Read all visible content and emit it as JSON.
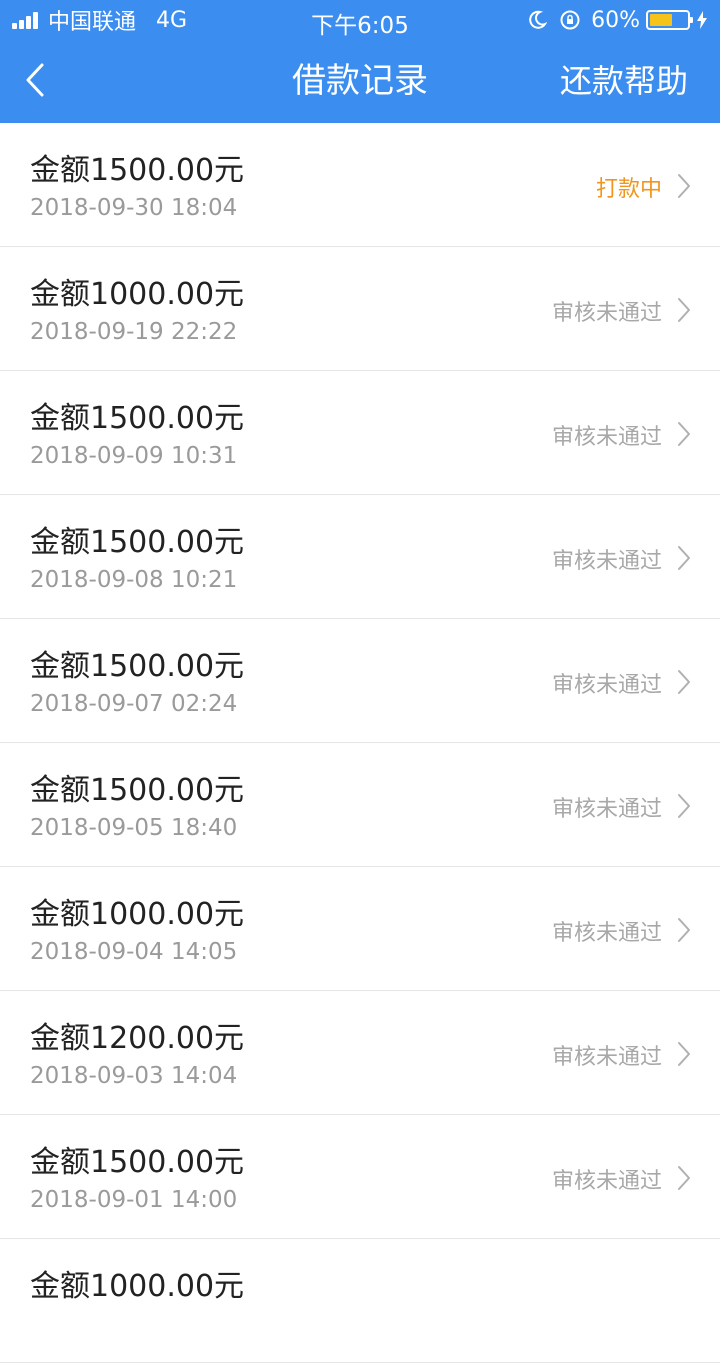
{
  "status_bar": {
    "carrier": "中国联通",
    "network": "4G",
    "time": "下午6:05",
    "battery_text": "60%",
    "battery_level": 0.6,
    "battery_color": "#f5c31a"
  },
  "header": {
    "back_icon": "chevron-left-icon",
    "title": "借款记录",
    "help_label": "还款帮助",
    "bg_color": "#3b8df0"
  },
  "status_colors": {
    "processing": "#f0961e",
    "rejected": "#a8a8a8"
  },
  "records": [
    {
      "amount": "金额1500.00元",
      "date": "2018-09-30 18:04",
      "status": "打款中",
      "status_type": "processing"
    },
    {
      "amount": "金额1000.00元",
      "date": "2018-09-19 22:22",
      "status": "审核未通过",
      "status_type": "rejected"
    },
    {
      "amount": "金额1500.00元",
      "date": "2018-09-09 10:31",
      "status": "审核未通过",
      "status_type": "rejected"
    },
    {
      "amount": "金额1500.00元",
      "date": "2018-09-08 10:21",
      "status": "审核未通过",
      "status_type": "rejected"
    },
    {
      "amount": "金额1500.00元",
      "date": "2018-09-07 02:24",
      "status": "审核未通过",
      "status_type": "rejected"
    },
    {
      "amount": "金额1500.00元",
      "date": "2018-09-05 18:40",
      "status": "审核未通过",
      "status_type": "rejected"
    },
    {
      "amount": "金额1000.00元",
      "date": "2018-09-04 14:05",
      "status": "审核未通过",
      "status_type": "rejected"
    },
    {
      "amount": "金额1200.00元",
      "date": "2018-09-03 14:04",
      "status": "审核未通过",
      "status_type": "rejected"
    },
    {
      "amount": "金额1500.00元",
      "date": "2018-09-01 14:00",
      "status": "审核未通过",
      "status_type": "rejected"
    },
    {
      "amount": "金额1000.00元",
      "date": "",
      "status": "",
      "status_type": "rejected"
    }
  ]
}
